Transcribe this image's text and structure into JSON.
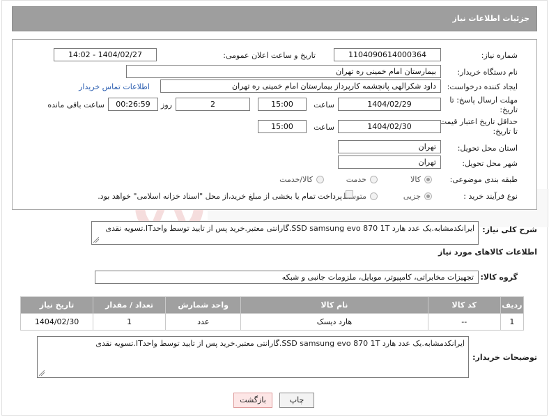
{
  "header": {
    "title": "جزئیات اطلاعات نیاز"
  },
  "fields": {
    "need_number": {
      "label": "شماره نیاز:",
      "value": "1104090614000364"
    },
    "announce_datetime": {
      "label": "تاریخ و ساعت اعلان عمومی:",
      "value": "1404/02/27 - 14:02"
    },
    "buyer_org": {
      "label": "نام دستگاه خریدار:",
      "value": "بیمارستان امام خمینی ره  تهران"
    },
    "requester": {
      "label": "ایجاد کننده درخواست:",
      "value": "داود شکرالهی پانچشمه کارپرداز بیمارستان امام خمینی ره  تهران",
      "contact_link": "اطلاعات تماس خریدار"
    },
    "reply_deadline": {
      "label_line1": "مهلت ارسال پاسخ: تا",
      "label_line2": "تاریخ:",
      "date": "1404/02/29",
      "time_label": "ساعت",
      "time": "15:00",
      "days": "2",
      "days_label": "روز و",
      "remaining": "00:26:59",
      "remaining_label": "ساعت باقی مانده"
    },
    "price_validity": {
      "label_line1": "حداقل تاریخ اعتبار قیمت:",
      "label_line2": "تا تاریخ:",
      "date": "1404/02/30",
      "time_label": "ساعت",
      "time": "15:00"
    },
    "delivery_province": {
      "label": "استان محل تحویل:",
      "value": "تهران"
    },
    "delivery_city": {
      "label": "شهر محل تحویل:",
      "value": "تهران"
    },
    "category": {
      "label": "طبقه بندی موضوعی:",
      "options": [
        "کالا",
        "خدمت",
        "کالا/خدمت"
      ],
      "selected": "کالا"
    },
    "process_type": {
      "label": "نوع فرآیند خرید :",
      "options": [
        "جزیی",
        "متوسط"
      ],
      "selected": "جزیی",
      "payment_note": "پرداخت تمام یا بخشی از مبلغ خرید،از محل \"اسناد خزانه اسلامی\" خواهد بود."
    }
  },
  "general_description": {
    "label": "شرح کلی نیاز:",
    "value": "ایرانکدمشابه.یک عدد هارد SSD samsung evo 870 1T.گارانتی معتبر.خرید پس از تایید توسط واحدIT.تسویه نقدی"
  },
  "goods_info": {
    "section_title": "اطلاعات کالاهای مورد نیاز",
    "group_label": "گروه کالا:",
    "group_value": "تجهیزات مخابراتی، کامپیوتر، موبایل، ملزومات جانبی و شبکه",
    "table": {
      "headers": [
        "ردیف",
        "کد کالا",
        "نام کالا",
        "واحد شمارش",
        "تعداد / مقدار",
        "تاریخ نیاز"
      ],
      "rows": [
        [
          "1",
          "--",
          "هارد دیسک",
          "عدد",
          "1",
          "1404/02/30"
        ]
      ]
    }
  },
  "buyer_notes": {
    "label": "توضیحات خریدار:",
    "value": "ایرانکدمشابه.یک عدد هارد SSD samsung evo 870 1T.گارانتی معتبر.خرید پس از تایید توسط واحدIT.تسویه نقدی"
  },
  "buttons": {
    "print": "چاپ",
    "back": "بازگشت"
  },
  "colors": {
    "header_bg": "#9e9e9e",
    "table_header_bg": "#a0a0a0",
    "link": "#2a5db0",
    "back_button_bg": "#fde6e6"
  }
}
